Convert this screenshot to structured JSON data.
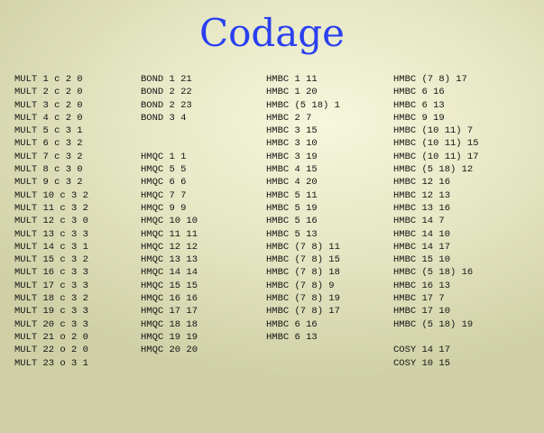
{
  "title": "Codage",
  "columns": [
    [
      "MULT 1 c 2 0",
      "MULT 2 c 2 0",
      "MULT 3 c 2 0",
      "MULT 4 c 2 0",
      "MULT 5 c 3 1",
      "MULT 6 c 3 2",
      "MULT 7 c 3 2",
      "MULT 8 c 3 0",
      "MULT 9 c 3 2",
      "MULT 10 c 3 2",
      "MULT 11 c 3 2",
      "MULT 12 c 3 0",
      "MULT 13 c 3 3",
      "MULT 14 c 3 1",
      "MULT 15 c 3 2",
      "MULT 16 c 3 3",
      "MULT 17 c 3 3",
      "MULT 18 c 3 2",
      "MULT 19 c 3 3",
      "MULT 20 c 3 3",
      "MULT 21 o 2 0",
      "MULT 22 o 2 0",
      "MULT 23 o 3 1"
    ],
    [
      "BOND 1 21",
      "BOND 2 22",
      "BOND 2 23",
      "BOND 3 4",
      "",
      "",
      "HMQC 1 1",
      "HMQC 5 5",
      "HMQC 6 6",
      "HMQC 7 7",
      "HMQC 9 9",
      "HMQC 10 10",
      "HMQC 11 11",
      "HMQC 12 12",
      "HMQC 13 13",
      "HMQC 14 14",
      "HMQC 15 15",
      "HMQC 16 16",
      "HMQC 17 17",
      "HMQC 18 18",
      "HMQC 19 19",
      "HMQC 20 20"
    ],
    [
      "HMBC 1 11",
      "HMBC 1 20",
      "HMBC (5 18) 1",
      "HMBC 2 7",
      "HMBC 3 15",
      "HMBC 3 10",
      "HMBC 3 19",
      "HMBC 4 15",
      "HMBC 4 20",
      "HMBC 5 11",
      "HMBC 5 19",
      "HMBC 5 16",
      "HMBC 5 13",
      "HMBC (7 8) 11",
      "HMBC (7 8) 15",
      "HMBC (7 8) 18",
      "HMBC (7 8) 9",
      "HMBC (7 8) 19",
      "HMBC (7 8) 17",
      "HMBC 6 16",
      "HMBC 6 13"
    ],
    [
      "HMBC (7 8) 17",
      "HMBC 6 16",
      "HMBC 6 13",
      "HMBC 9 19",
      "HMBC (10 11) 7",
      "HMBC (10 11) 15",
      "HMBC (10 11) 17",
      "HMBC (5 18) 12",
      "HMBC 12 16",
      "HMBC 12 13",
      "HMBC 13 16",
      "HMBC 14 7",
      "HMBC 14 10",
      "HMBC 14 17",
      "HMBC 15 10",
      "HMBC (5 18) 16",
      "HMBC 16 13",
      "HMBC 17 7",
      "HMBC 17 10",
      "HMBC (5 18) 19",
      "",
      "COSY 14 17",
      "COSY 10 15"
    ]
  ]
}
